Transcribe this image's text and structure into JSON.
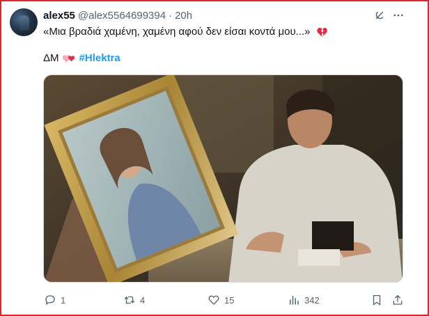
{
  "tweet": {
    "author_name": "alex55",
    "handle": "@alex5564699394",
    "separator": "·",
    "time": "20h",
    "text_line1": "«Μια βραδιά χαμένη, χαμένη αφού δεν είσαι κοντά μου...»",
    "text_line2_prefix": "ΔΜ",
    "hashtag": "#Hlektra",
    "emoji_broken_heart": "broken-heart-icon",
    "emoji_hearts": "revolving-hearts-icon"
  },
  "media": {
    "description_icon": "video-still-icon"
  },
  "actions": {
    "replies": "1",
    "reposts": "4",
    "likes": "15",
    "views": "342"
  },
  "colors": {
    "accent": "#1d9bf0",
    "secondary_text": "#536471",
    "border": "#e0242b"
  }
}
